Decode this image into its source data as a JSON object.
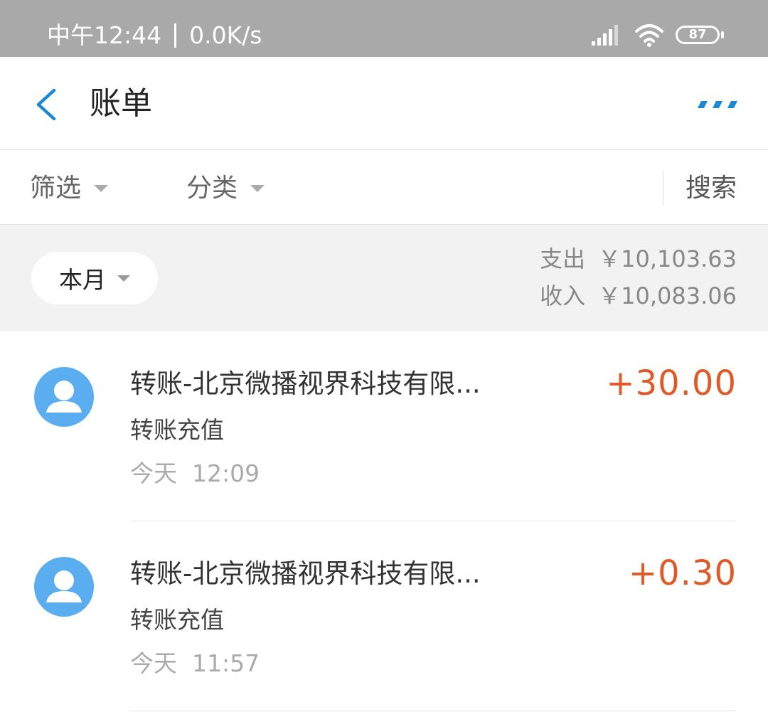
{
  "status_bar": {
    "time": "中午12:44",
    "speed": "0.0K/s",
    "battery": "87"
  },
  "header": {
    "title": "账单"
  },
  "filters": {
    "filter_label": "筛选",
    "category_label": "分类",
    "search_label": "搜索"
  },
  "summary": {
    "period": "本月",
    "expense_label": "支出",
    "expense_value": "￥10,103.63",
    "income_label": "收入",
    "income_value": "￥10,083.06"
  },
  "transactions": [
    {
      "title": "转账-北京微播视界科技有限...",
      "subtitle": "转账充值",
      "date": "今天",
      "time": "12:09",
      "amount": "+30.00"
    },
    {
      "title": "转账-北京微播视界科技有限...",
      "subtitle": "转账充值",
      "date": "今天",
      "time": "11:57",
      "amount": "+0.30"
    }
  ],
  "colors": {
    "accent": "#1a88d4",
    "income": "#e05a28",
    "avatar": "#5aaef0"
  }
}
